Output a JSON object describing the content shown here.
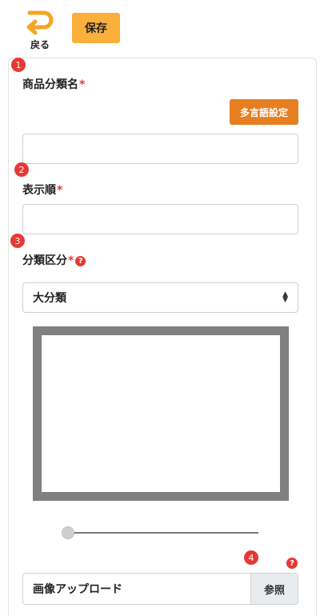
{
  "header": {
    "back_label": "戻る",
    "save_label": "保存"
  },
  "form": {
    "step1": {
      "badge": "1",
      "label": "商品分類名",
      "required_mark": "*",
      "multilang_button": "多言語設定",
      "value": ""
    },
    "step2": {
      "badge": "2",
      "label": "表示順",
      "required_mark": "*",
      "value": ""
    },
    "step3": {
      "badge": "3",
      "label": "分類区分",
      "required_mark": "*",
      "help": "?",
      "selected": "大分類"
    },
    "step4": {
      "badge": "4",
      "help": "?",
      "upload_label": "画像アップロード",
      "browse_button": "参照"
    }
  },
  "colors": {
    "save_button": "#fbb03b",
    "multilang_button": "#e67e22",
    "badge": "#e53935",
    "back_arrow": "#f5a623"
  },
  "icons": {
    "back": "return-arrow-icon",
    "help": "question-circle-icon",
    "select": "sort-arrows-icon"
  }
}
